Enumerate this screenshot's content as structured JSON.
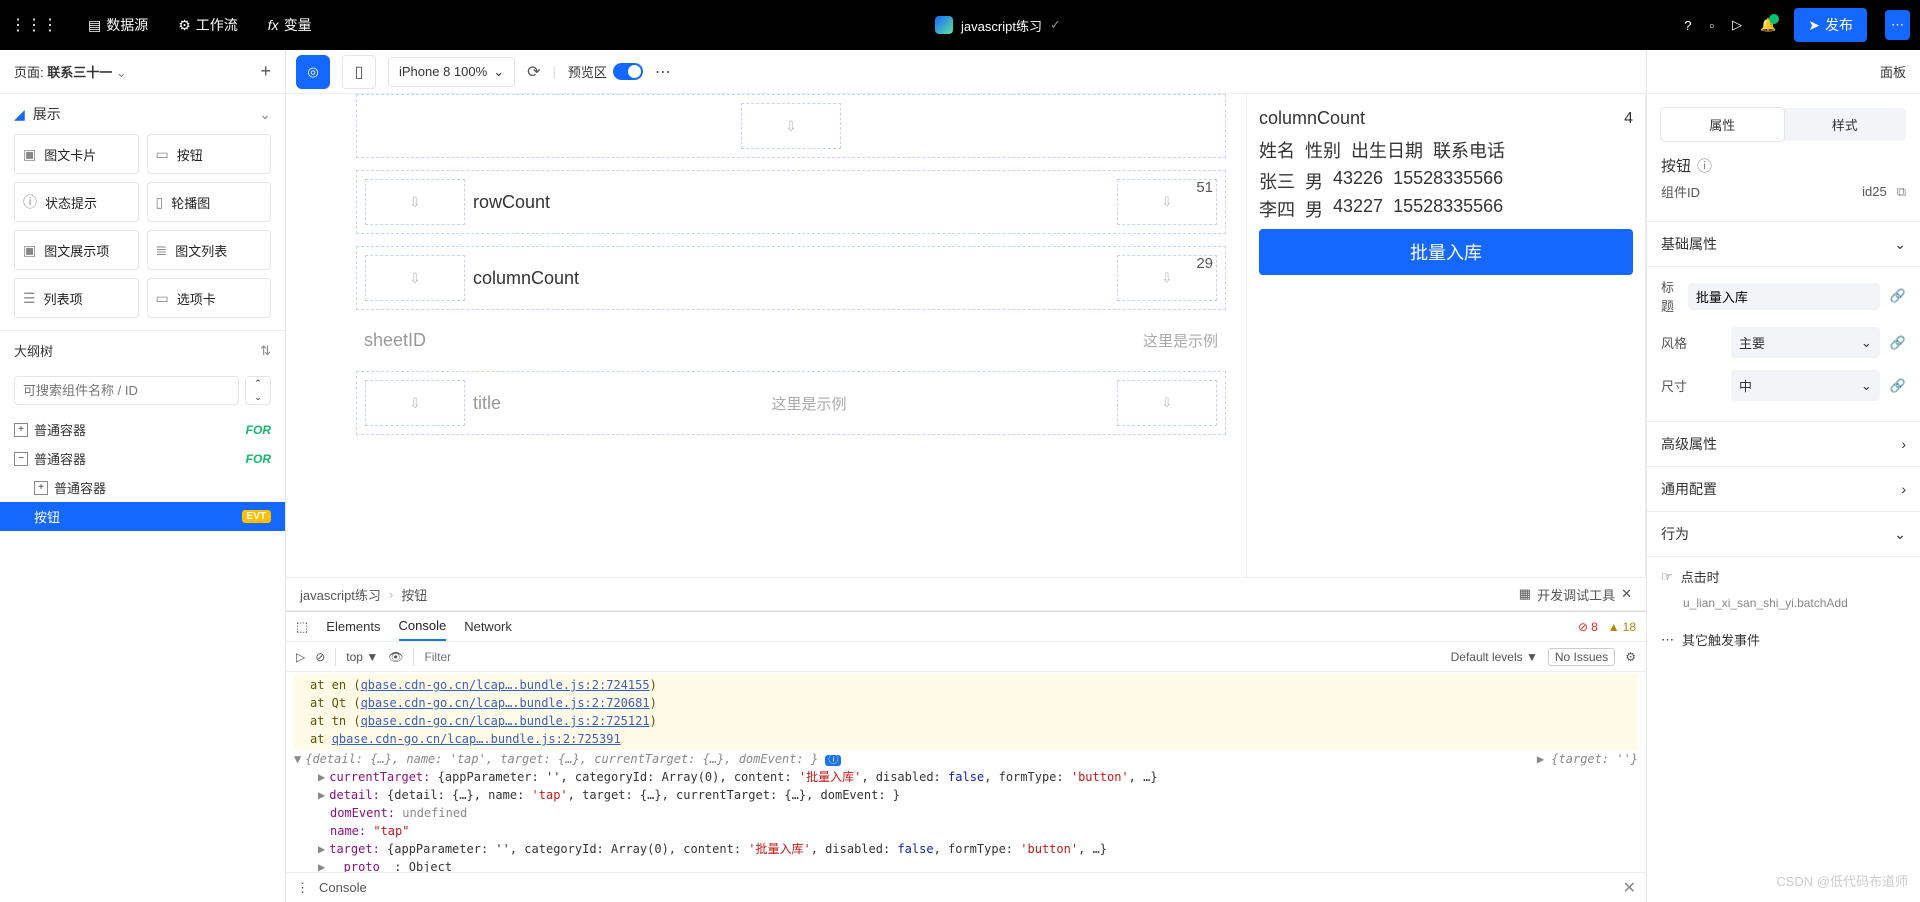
{
  "topbar": {
    "dataSource": "数据源",
    "workflow": "工作流",
    "variable": "变量",
    "projectName": "javascript练习",
    "publish": "发布"
  },
  "leftPanel": {
    "pageLabel": "页面:",
    "pageName": "联系三十一",
    "sectionDisplay": "展示",
    "components": {
      "c0": "图文卡片",
      "c1": "按钮",
      "c2": "状态提示",
      "c3": "轮播图",
      "c4": "图文展示项",
      "c5": "图文列表",
      "c6": "列表项",
      "c7": "选项卡"
    },
    "outlineTitle": "大纲树",
    "searchPlaceholder": "可搜索组件名称 / ID",
    "tree": {
      "t0": "普通容器",
      "t1": "普通容器",
      "t2": "普通容器",
      "t3": "按钮",
      "tagFor": "FOR",
      "tagEvt": "EVT"
    }
  },
  "toolbar": {
    "zoom": "iPhone 8 100%",
    "previewLabel": "预览区"
  },
  "design": {
    "b0": {
      "label": "rowCount",
      "val": "51"
    },
    "b1": {
      "label": "columnCount",
      "val": "29"
    },
    "b2": {
      "label": "sheetID",
      "ph": "这里是示例"
    },
    "b3": {
      "label": "title",
      "ph": "这里是示例"
    }
  },
  "phone": {
    "colLabel": "columnCount",
    "colVal": "4",
    "h0": "姓名",
    "h1": "性别",
    "h2": "出生日期",
    "h3": "联系电话",
    "r0c0": "张三",
    "r0c1": "男",
    "r0c2": "43226",
    "r0c3": "15528335566",
    "r1c0": "李四",
    "r1c1": "男",
    "r1c2": "43227",
    "r1c3": "15528335566",
    "btn": "批量入库"
  },
  "breadcrumb": {
    "b0": "javascript练习",
    "b1": "按钮",
    "right": "开发调试工具"
  },
  "devtools": {
    "t0": "Elements",
    "t1": "Console",
    "t2": "Network",
    "errCount": "8",
    "warnCount": "18",
    "top": "top",
    "filterPh": "Filter",
    "levels": "Default levels",
    "issues": "No Issues",
    "stack": {
      "s0a": "at en (",
      "s0b": "qbase.cdn-go.cn/lcap….bundle.js:2:724155",
      "s0c": ")",
      "s1a": "at Qt (",
      "s1b": "qbase.cdn-go.cn/lcap….bundle.js:2:720681",
      "s2a": "at tn (",
      "s2b": "qbase.cdn-go.cn/lcap….bundle.js:2:725121",
      "s3a": "at ",
      "s3b": "qbase.cdn-go.cn/lcap….bundle.js:2:725391"
    },
    "topline": "{detail: {…}, name: 'tap', target: {…}, currentTarget: {…}, domEvent: }",
    "toplineRight": "▶ {target: ''}",
    "l0a": "currentTarget:",
    "l0b": " {appParameter: '', categoryId: Array(0), content: ",
    "l0c": "'批量入库'",
    "l0d": ", disabled: ",
    "l0e": "false",
    "l0f": ", formType: ",
    "l0g": "'button'",
    "l0h": ", …}",
    "l1a": "detail:",
    "l1b": " {detail: {…}, name: ",
    "l1c": "'tap'",
    "l1d": ", target: {…}, currentTarget: {…}, domEvent: }",
    "l2a": "domEvent:",
    "l2b": " undefined",
    "l3a": "name:",
    "l3b": " \"tap\"",
    "l4a": "target:",
    "l4b": " {appParameter: '', categoryId: Array(0), content: ",
    "l4c": "'批量入库'",
    "l4d": ", disabled: ",
    "l4e": "false",
    "l4f": ", formType: ",
    "l4g": "'button'",
    "l4h": ", …}",
    "l5a": "__proto__",
    "l5b": ": Object",
    "footer": "Console"
  },
  "rightPanel": {
    "headLabel": "面板",
    "tabProp": "属性",
    "tabStyle": "样式",
    "compTitle": "按钮",
    "compIdLabel": "组件ID",
    "compId": "id25",
    "baseTitle": "基础属性",
    "titleLabel": "标题",
    "titleVal": "批量入库",
    "styleLabel": "风格",
    "styleVal": "主要",
    "sizeLabel": "尺寸",
    "sizeVal": "中",
    "adv": "高级属性",
    "common": "通用配置",
    "behavior": "行为",
    "onClick": "点击时",
    "handler": "u_lian_xi_san_shi_yi.batchAdd",
    "other": "其它触发事件"
  },
  "watermark": "CSDN @低代码布道师"
}
